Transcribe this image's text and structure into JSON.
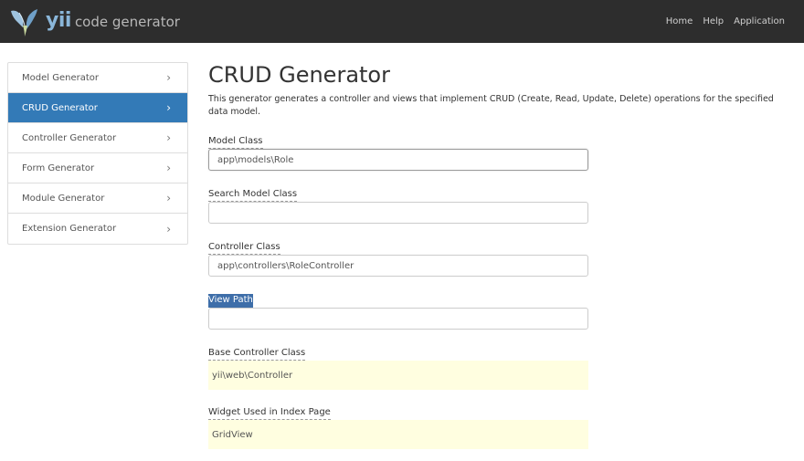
{
  "navbar": {
    "brand_yii": "yii",
    "brand_text": "code generator",
    "links": [
      "Home",
      "Help",
      "Application"
    ]
  },
  "sidebar": {
    "items": [
      {
        "label": "Model Generator",
        "active": false
      },
      {
        "label": "CRUD Generator",
        "active": true
      },
      {
        "label": "Controller Generator",
        "active": false
      },
      {
        "label": "Form Generator",
        "active": false
      },
      {
        "label": "Module Generator",
        "active": false
      },
      {
        "label": "Extension Generator",
        "active": false
      }
    ]
  },
  "main": {
    "title": "CRUD Generator",
    "description": "This generator generates a controller and views that implement CRUD (Create, Read, Update, Delete) operations for the specified data model.",
    "fields": [
      {
        "label": "Model Class",
        "value": "app\\models\\Role"
      },
      {
        "label": "Search Model Class",
        "value": ""
      },
      {
        "label": "Controller Class",
        "value": "app\\controllers\\RoleController"
      },
      {
        "label": "View Path",
        "value": ""
      },
      {
        "label": "Base Controller Class",
        "value": "yii\\web\\Controller"
      },
      {
        "label": "Widget Used in Index Page",
        "value": "GridView"
      }
    ]
  },
  "colors": {
    "navbar_bg": "#2d2d2d",
    "active_item": "#337ab7",
    "sticky_bg": "#fffee0",
    "selection": "#3e6ea9"
  }
}
